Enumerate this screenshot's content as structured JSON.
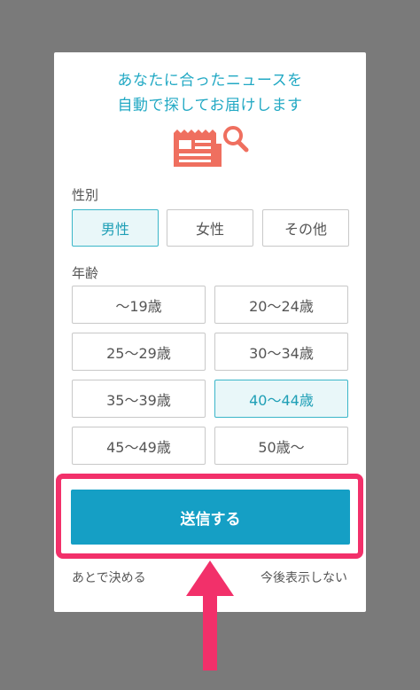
{
  "dialog": {
    "headline_line1": "あなたに合ったニュースを",
    "headline_line2": "自動で探してお届けします",
    "icon": "newspaper-search-icon"
  },
  "gender": {
    "label": "性別",
    "options": [
      "男性",
      "女性",
      "その他"
    ],
    "selected": "男性"
  },
  "age": {
    "label": "年齢",
    "options": [
      "〜19歳",
      "20〜24歳",
      "25〜29歳",
      "30〜34歳",
      "35〜39歳",
      "40〜44歳",
      "45〜49歳",
      "50歳〜"
    ],
    "selected": "40〜44歳"
  },
  "actions": {
    "submit_label": "送信する",
    "later_label": "あとで決める",
    "never_label": "今後表示しない"
  },
  "annotation": {
    "highlight_color": "#f2306a",
    "arrow_icon": "up-arrow-icon"
  },
  "colors": {
    "accent": "#22a9c4",
    "button": "#159fc5",
    "overlay": "#7a7a7a",
    "icon": "#ef6f5f"
  }
}
